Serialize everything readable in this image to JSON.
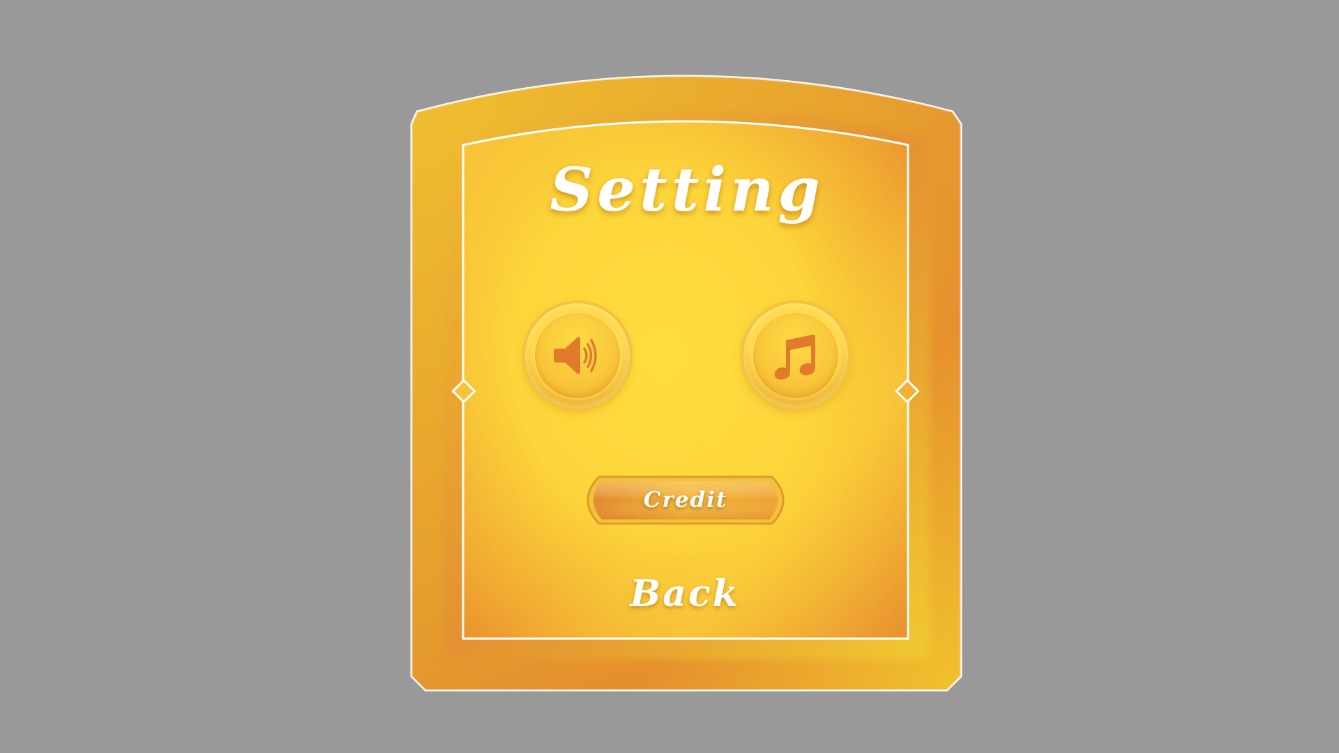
{
  "menu": {
    "title": "Setting",
    "buttons": {
      "sound": {
        "icon": "speaker-volume-icon"
      },
      "music": {
        "icon": "music-note-icon"
      },
      "credit_label": "Credit",
      "back_label": "Back"
    }
  },
  "colors": {
    "background": "#999999",
    "panel_light": "#ffdc3c",
    "panel_dark": "#e68a2e",
    "frame_line": "#ffffff",
    "icon_color": "#e17a2a"
  }
}
